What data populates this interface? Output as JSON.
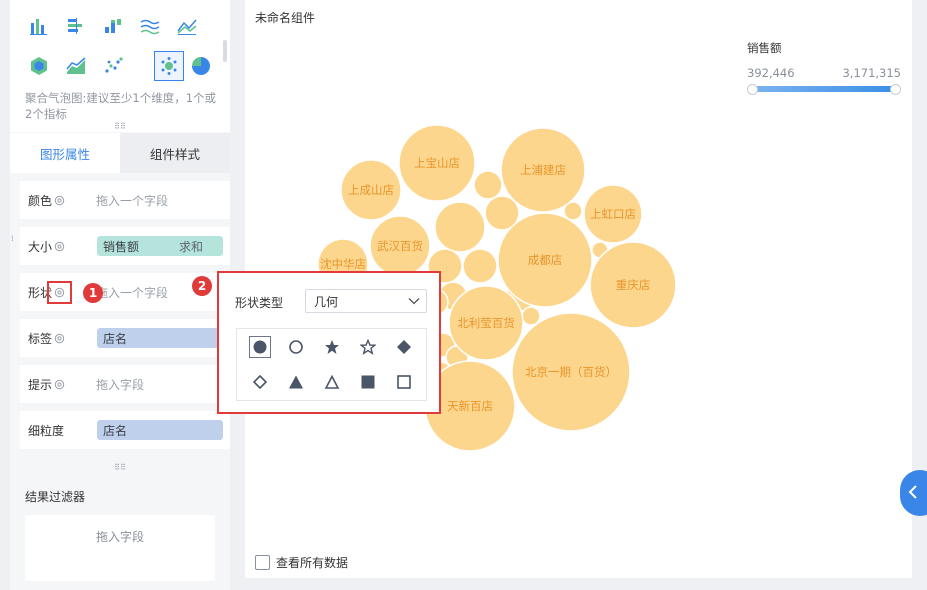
{
  "chart_types": {
    "icons": [
      "bar-chart-icon",
      "horizontal-bar-icon",
      "stacked-bar-icon",
      "multi-line-icon",
      "line-area-icon",
      "gradient-hex-icon",
      "area-chart-icon",
      "scatter-icon",
      "bubble-chart-icon",
      "pie-chart-icon"
    ],
    "selected": "bubble-chart-icon",
    "hint": "聚合气泡图:建议至少1个维度，1个或2个指标"
  },
  "tabs": [
    {
      "label": "图形属性",
      "active": true
    },
    {
      "label": "组件样式",
      "active": false
    }
  ],
  "properties": {
    "color": {
      "label": "颜色",
      "placeholder": "拖入一个字段"
    },
    "size": {
      "label": "大小",
      "field": "销售额",
      "agg": "求和"
    },
    "shape": {
      "label": "形状",
      "placeholder": "拖入一个字段"
    },
    "tag": {
      "label": "标签",
      "field": "店名"
    },
    "tooltip": {
      "label": "提示",
      "placeholder": "拖入字段"
    },
    "granularity": {
      "label": "细粒度",
      "field": "店名"
    }
  },
  "filter": {
    "title": "结果过滤器",
    "placeholder": "拖入字段"
  },
  "canvas": {
    "title": "未命名组件",
    "view_all": "查看所有数据"
  },
  "legend": {
    "title": "销售额",
    "min": "392,446",
    "max": "3,171,315"
  },
  "popup": {
    "type_label": "形状类型",
    "type_value": "几何",
    "shapes": [
      "filled-circle-icon",
      "circle-outline-icon",
      "filled-star-icon",
      "star-outline-icon",
      "filled-diamond-icon",
      "diamond-outline-icon",
      "filled-triangle-icon",
      "triangle-outline-icon",
      "filled-square-icon",
      "square-outline-icon"
    ],
    "selected_shape": "filled-circle-icon"
  },
  "badges": {
    "one": "1",
    "two": "2"
  },
  "colors": {
    "accent": "#3a86e8",
    "bubble": "#fdd68e",
    "bubble_text": "#e8952a",
    "annotation": "#e03a3a"
  },
  "chart_data": {
    "type": "bubble",
    "size_measure": "销售额",
    "size_range": [
      "392,446",
      "3,171,315"
    ],
    "labels": [
      "上宝山店",
      "上浦建店",
      "上成山店",
      "上虹口店",
      "武汉百货",
      "成都店",
      "沈中华店",
      "重庆店",
      "北利莹百货",
      "北京一期（百货）",
      "天新百店"
    ]
  }
}
